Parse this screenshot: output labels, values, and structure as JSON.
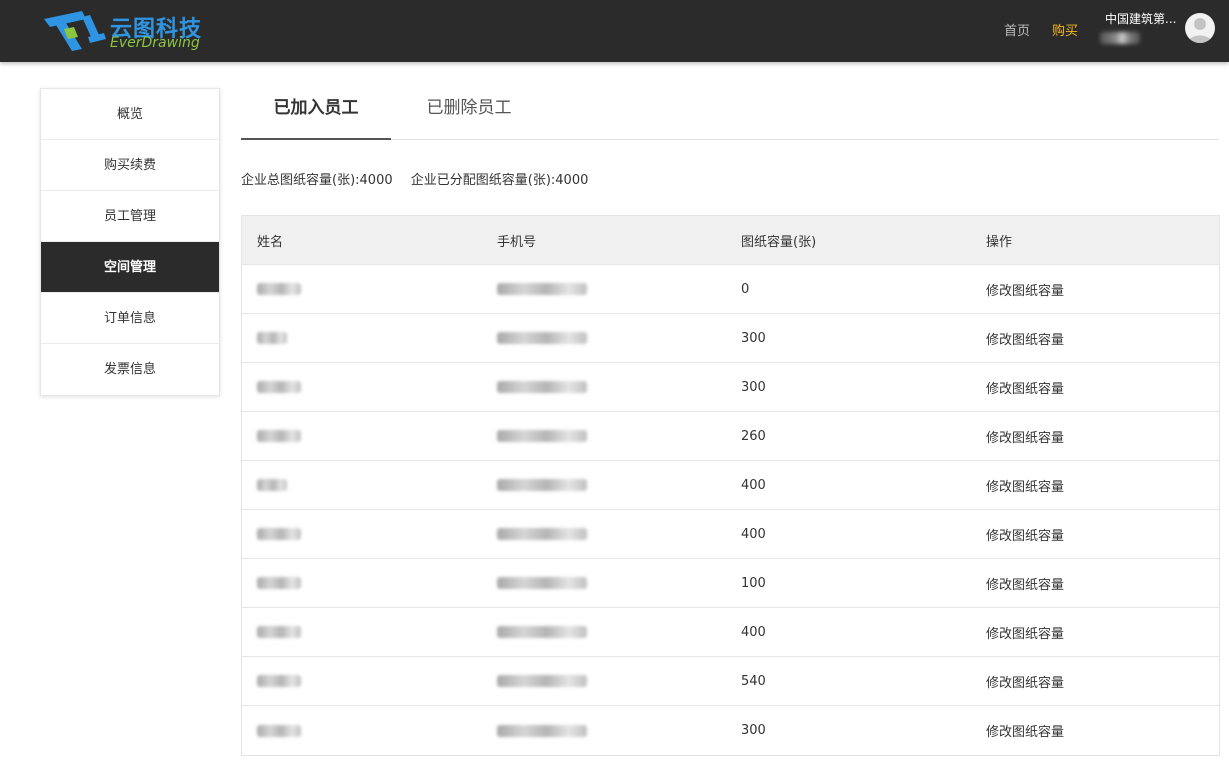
{
  "header": {
    "logo_cn": "云图科技",
    "logo_en": "EverDrawing",
    "nav_home": "首页",
    "nav_buy": "购买",
    "user_company": "中国建筑第...",
    "colors": {
      "bar": "#2b2b2b",
      "buy": "#f5b820",
      "logo_blue": "#2f95e3",
      "logo_green": "#8cc63f"
    }
  },
  "sidebar": {
    "items": [
      {
        "label": "概览"
      },
      {
        "label": "购买续费"
      },
      {
        "label": "员工管理"
      },
      {
        "label": "空间管理",
        "active": true
      },
      {
        "label": "订单信息"
      },
      {
        "label": "发票信息"
      }
    ]
  },
  "tabs": [
    {
      "label": "已加入员工",
      "active": true
    },
    {
      "label": "已删除员工"
    }
  ],
  "summary": {
    "total": "企业总图纸容量(张):4000",
    "allocated": "企业已分配图纸容量(张):4000"
  },
  "table": {
    "columns": [
      "姓名",
      "手机号",
      "图纸容量(张)",
      "操作"
    ],
    "rows": [
      {
        "capacity": "0",
        "action": "修改图纸容量"
      },
      {
        "capacity": "300",
        "action": "修改图纸容量"
      },
      {
        "capacity": "300",
        "action": "修改图纸容量"
      },
      {
        "capacity": "260",
        "action": "修改图纸容量"
      },
      {
        "capacity": "400",
        "action": "修改图纸容量"
      },
      {
        "capacity": "400",
        "action": "修改图纸容量"
      },
      {
        "capacity": "100",
        "action": "修改图纸容量"
      },
      {
        "capacity": "400",
        "action": "修改图纸容量"
      },
      {
        "capacity": "540",
        "action": "修改图纸容量"
      },
      {
        "capacity": "300",
        "action": "修改图纸容量"
      }
    ]
  }
}
